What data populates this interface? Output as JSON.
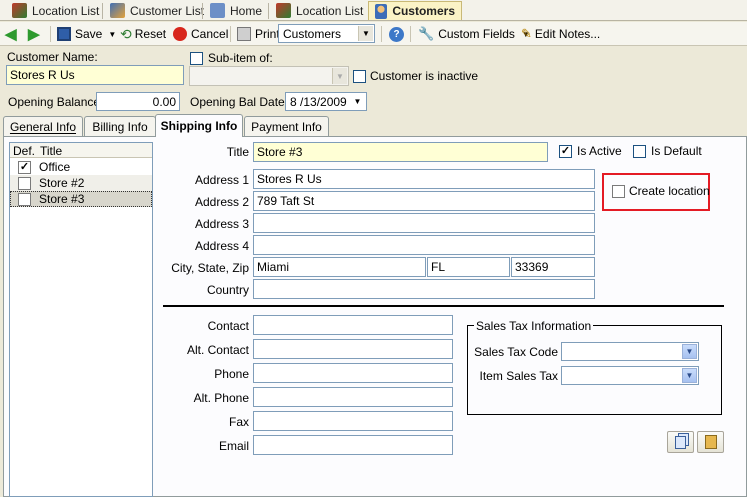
{
  "tabs": [
    {
      "label": "Location List",
      "icon": "location-list-icon"
    },
    {
      "label": "Customer List",
      "icon": "customer-list-icon"
    },
    {
      "label": "Home",
      "icon": "home-icon"
    },
    {
      "label": "Location List",
      "icon": "location-list-icon"
    },
    {
      "label": "Customers",
      "icon": "customer-icon",
      "active": true
    }
  ],
  "toolbar": {
    "save": "Save",
    "reset": "Reset",
    "cancel": "Cancel",
    "print": "Print",
    "print_target": "Customers",
    "custom_fields": "Custom Fields",
    "edit_notes": "Edit Notes..."
  },
  "customer": {
    "name_label": "Customer Name:",
    "name": "Stores R Us",
    "subitem_label": "Sub-item of:",
    "subitem_value": "",
    "inactive_label": "Customer is inactive",
    "opening_balance_label": "Opening Balance:",
    "opening_balance": "0.00",
    "opening_date_label": "Opening Bal Date:",
    "opening_date": "8 /13/2009"
  },
  "section_tabs": [
    {
      "label": "General Info"
    },
    {
      "label": "Billing Info"
    },
    {
      "label": "Shipping Info",
      "active": true
    },
    {
      "label": "Payment Info"
    }
  ],
  "location_list": {
    "headers": {
      "def": "Def.",
      "title": "Title"
    },
    "rows": [
      {
        "checked": true,
        "title": "Office"
      },
      {
        "checked": false,
        "title": "Store #2"
      },
      {
        "checked": false,
        "title": "Store #3",
        "selected": true
      }
    ]
  },
  "shipping": {
    "title_label": "Title",
    "title": "Store #3",
    "is_active_label": "Is Active",
    "is_active": true,
    "is_default_label": "Is Default",
    "is_default": false,
    "create_location_label": "Create location",
    "create_location": false,
    "address1_label": "Address 1",
    "address1": "Stores R Us",
    "address2_label": "Address 2",
    "address2": "789 Taft St",
    "address3_label": "Address 3",
    "address3": "",
    "address4_label": "Address 4",
    "address4": "",
    "csz_label": "City, State, Zip",
    "city": "Miami",
    "state": "FL",
    "zip": "33369",
    "country_label": "Country",
    "country": "",
    "contact_label": "Contact",
    "contact": "",
    "alt_contact_label": "Alt. Contact",
    "alt_contact": "",
    "phone_label": "Phone",
    "phone": "",
    "alt_phone_label": "Alt. Phone",
    "alt_phone": "",
    "fax_label": "Fax",
    "fax": "",
    "email_label": "Email",
    "email": ""
  },
  "sales_tax": {
    "group_label": "Sales Tax Information",
    "code_label": "Sales Tax Code",
    "code": "",
    "item_label": "Item Sales Tax",
    "item": ""
  },
  "colors": {
    "highlight_box": "#e41b24",
    "yellow_field": "#ffffd5",
    "active_tab": "#fbf3c6"
  }
}
